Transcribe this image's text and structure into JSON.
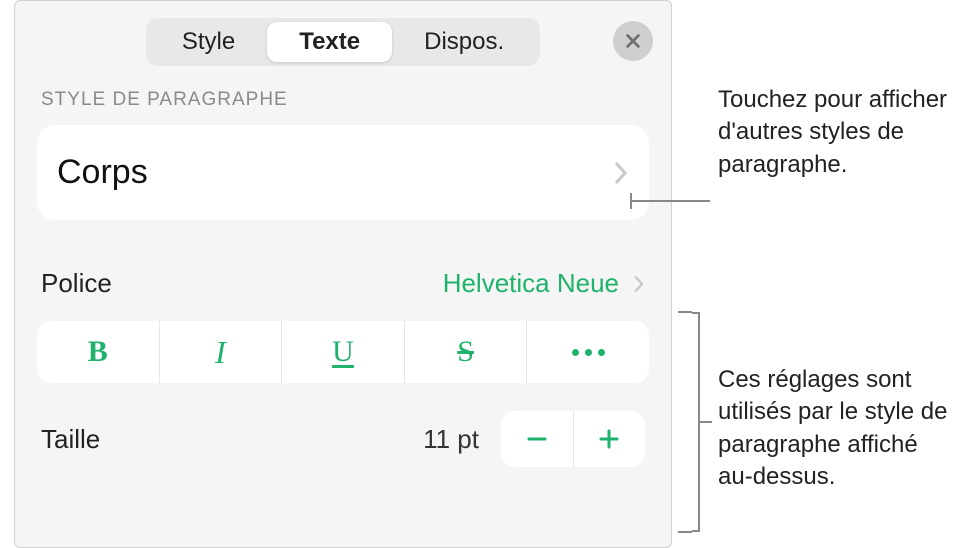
{
  "tabs": {
    "style": "Style",
    "texte": "Texte",
    "dispos": "Dispos."
  },
  "section_label": "Style de paragraphe",
  "paragraph_style": {
    "current": "Corps"
  },
  "font": {
    "label": "Police",
    "value": "Helvetica Neue"
  },
  "style_buttons": {
    "bold": "B",
    "italic": "I",
    "underline": "U",
    "strike": "S"
  },
  "size": {
    "label": "Taille",
    "value": "11 pt"
  },
  "callouts": {
    "paragraph": "Touchez pour afficher d'autres styles de paragraphe.",
    "settings": "Ces réglages sont utilisés par le style de paragraphe affiché au-dessus."
  }
}
